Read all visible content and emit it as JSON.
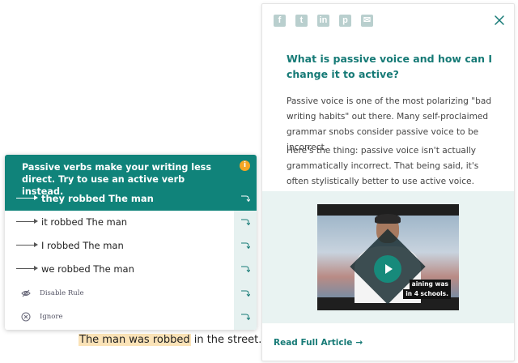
{
  "article": {
    "share_icons": [
      {
        "name": "facebook-icon",
        "glyph": "f"
      },
      {
        "name": "twitter-icon",
        "glyph": "t"
      },
      {
        "name": "linkedin-icon",
        "glyph": "in"
      },
      {
        "name": "pinterest-icon",
        "glyph": "p"
      },
      {
        "name": "email-icon",
        "glyph": "✉"
      }
    ],
    "title": "What is passive voice and how can I change it to active?",
    "paragraph1": "Passive voice is one of the most polarizing \"bad writing habits\" out there. Many self-proclaimed grammar snobs consider passive voice to be incorrect.",
    "paragraph2": "Here's the thing: passive voice isn't actually grammatically incorrect. That being said, it's often stylistically better to use active voice.",
    "video": {
      "caption_line1": "aining was",
      "caption_line2": "in 4 schools."
    },
    "read_full_label": "Read Full Article",
    "read_full_arrow": "→"
  },
  "document": {
    "highlighted_phrase": "The man was robbed",
    "rest_of_sentence": " in the street."
  },
  "suggestion_card": {
    "message": "Passive verbs make your writing less direct. Try to use an active verb instead.",
    "info_glyph": "i",
    "suggestions": [
      {
        "label": "they robbed The man",
        "selected": true
      },
      {
        "label": "it robbed The man",
        "selected": false
      },
      {
        "label": "I robbed The man",
        "selected": false
      },
      {
        "label": "we robbed The man",
        "selected": false
      }
    ],
    "disable_rule_label": "Disable Rule",
    "ignore_label": "Ignore"
  },
  "colors": {
    "accent": "#10837a",
    "accent_text": "#167a76",
    "highlight": "#fbe3b7",
    "info_badge": "#f5a623",
    "video_bg": "#e9f3f2"
  }
}
